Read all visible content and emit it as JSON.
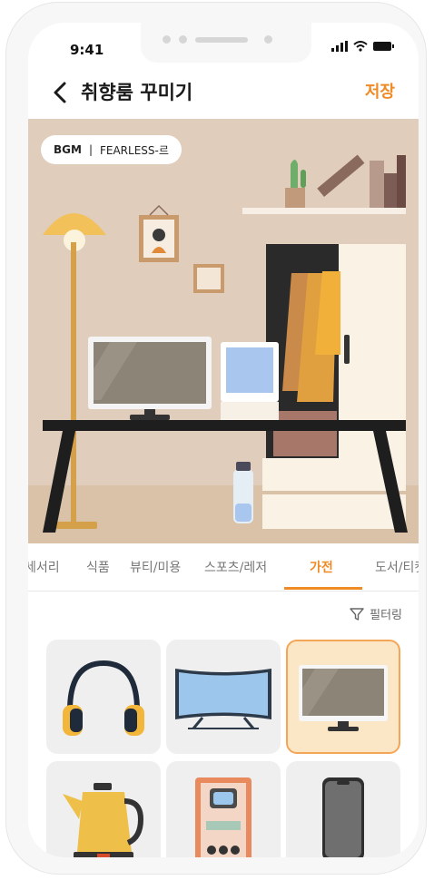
{
  "status_bar": {
    "time": "9:41"
  },
  "header": {
    "title": "취향룸 꾸미기",
    "save_label": "저장"
  },
  "bgm": {
    "label": "BGM",
    "song": "FEARLESS-르"
  },
  "tabs": [
    {
      "label": "세서리"
    },
    {
      "label": "식품"
    },
    {
      "label": "뷰티/미용"
    },
    {
      "label": "스포츠/레저"
    },
    {
      "label": "가전",
      "active": true
    },
    {
      "label": "도서/티켓"
    }
  ],
  "filter": {
    "label": "필터링"
  },
  "items": [
    {
      "icon": "headphones-icon",
      "selected": false
    },
    {
      "icon": "curved-tv-icon",
      "selected": false
    },
    {
      "icon": "monitor-icon",
      "selected": true
    },
    {
      "icon": "kettle-icon",
      "selected": false
    },
    {
      "icon": "radio-icon",
      "selected": false
    },
    {
      "icon": "smartphone-icon",
      "selected": false
    }
  ],
  "colors": {
    "accent": "#f08a24",
    "room_wall": "#e0cdbb",
    "room_floor": "#d9c2a8",
    "selected_bg": "#fbe7c6"
  }
}
